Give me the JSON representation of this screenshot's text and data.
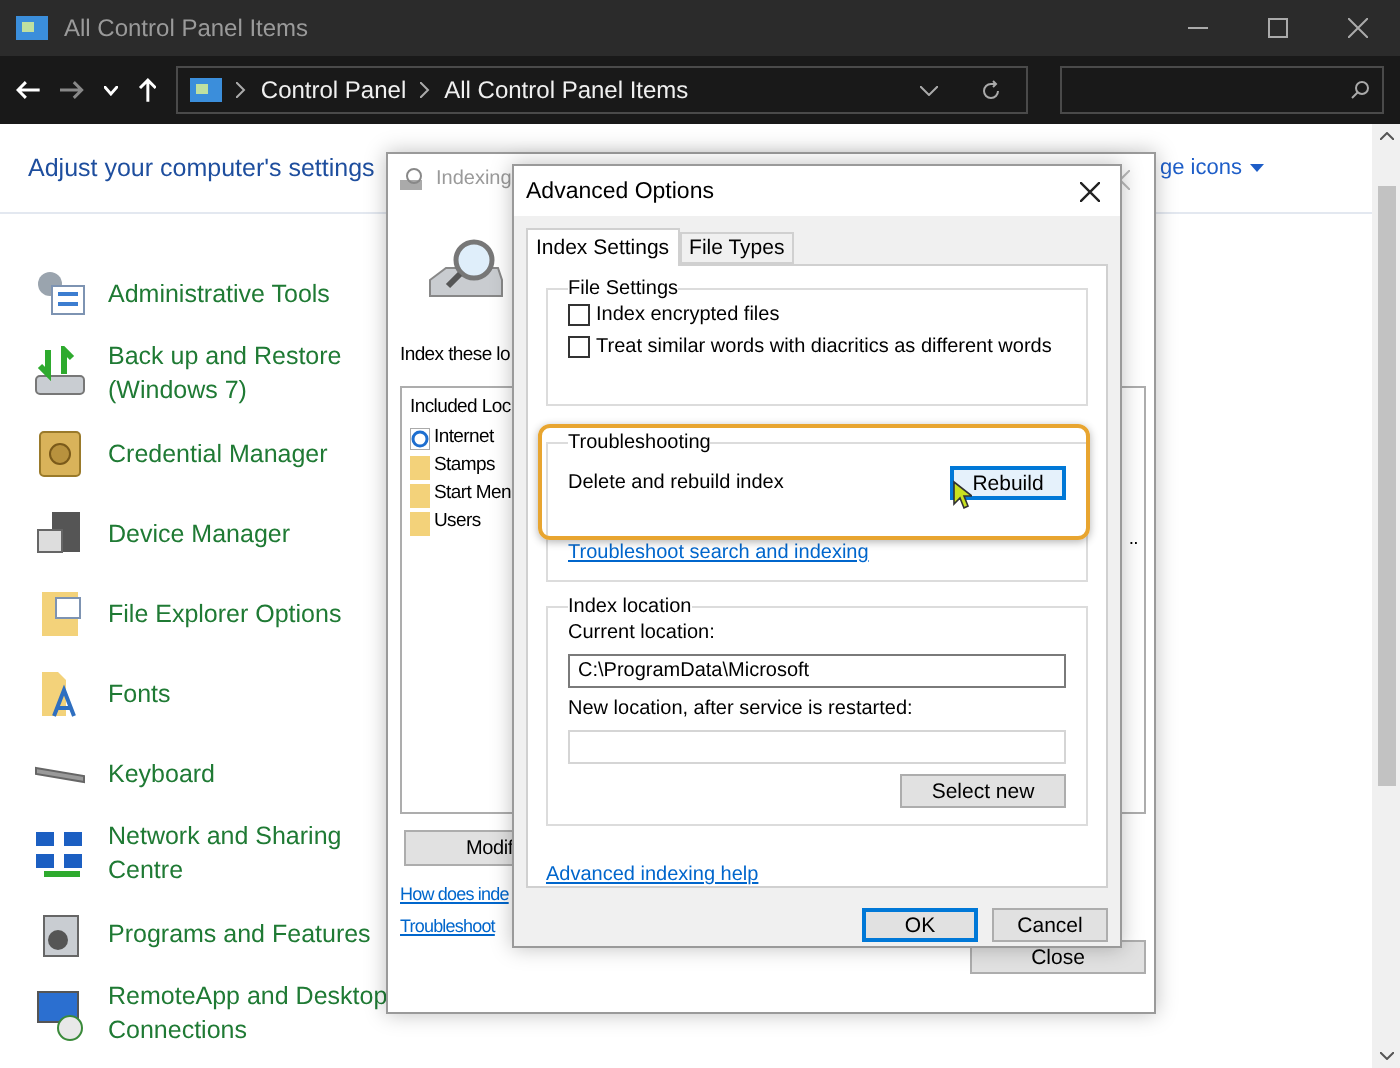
{
  "window": {
    "title": "All Control Panel Items"
  },
  "address_bar": {
    "crumbs": [
      "Control Panel",
      "All Control Panel Items"
    ]
  },
  "header": {
    "title": "Adjust your computer's settings",
    "view_by": "ge icons"
  },
  "items": [
    {
      "label": "Administrative Tools"
    },
    {
      "label": "Back up and Restore (Windows 7)"
    },
    {
      "label": "Credential Manager"
    },
    {
      "label": "Device Manager"
    },
    {
      "label": "File Explorer Options"
    },
    {
      "label": "Fonts"
    },
    {
      "label": "Keyboard"
    },
    {
      "label": "Network and Sharing Centre"
    },
    {
      "label": "Programs and Features"
    },
    {
      "label": "RemoteApp and Desktop Connections"
    }
  ],
  "indexing_dialog": {
    "title": "Indexing",
    "intro": "Index these lo",
    "list_heading": "Included Loc",
    "locations": [
      {
        "label": "Internet",
        "kind": "web"
      },
      {
        "label": "Stamps",
        "kind": "folder"
      },
      {
        "label": "Start Men",
        "kind": "folder"
      },
      {
        "label": "Users",
        "kind": "folder"
      }
    ],
    "overflow": "..",
    "modify_button": "Modif",
    "links": [
      "How does inde",
      "Troubleshoot"
    ],
    "close_button": "Close"
  },
  "advanced_dialog": {
    "title": "Advanced Options",
    "tabs": [
      {
        "label": "Index Settings",
        "selected": true
      },
      {
        "label": "File Types",
        "selected": false
      }
    ],
    "file_settings": {
      "title": "File Settings",
      "options": [
        {
          "label": "Index encrypted files",
          "checked": false
        },
        {
          "label": "Treat similar words with diacritics as different words",
          "checked": false
        }
      ]
    },
    "troubleshooting": {
      "title": "Troubleshooting",
      "text": "Delete and rebuild index",
      "button": "Rebuild",
      "highlighted": true,
      "link": "Troubleshoot search and indexing"
    },
    "index_location": {
      "title": "Index location",
      "current_label": "Current location:",
      "current_value": "C:\\ProgramData\\Microsoft",
      "new_label": "New location, after service is restarted:",
      "button": "Select new"
    },
    "help_link": "Advanced indexing help",
    "buttons": [
      {
        "label": "OK",
        "default": true
      },
      {
        "label": "Cancel",
        "default": false
      }
    ]
  }
}
